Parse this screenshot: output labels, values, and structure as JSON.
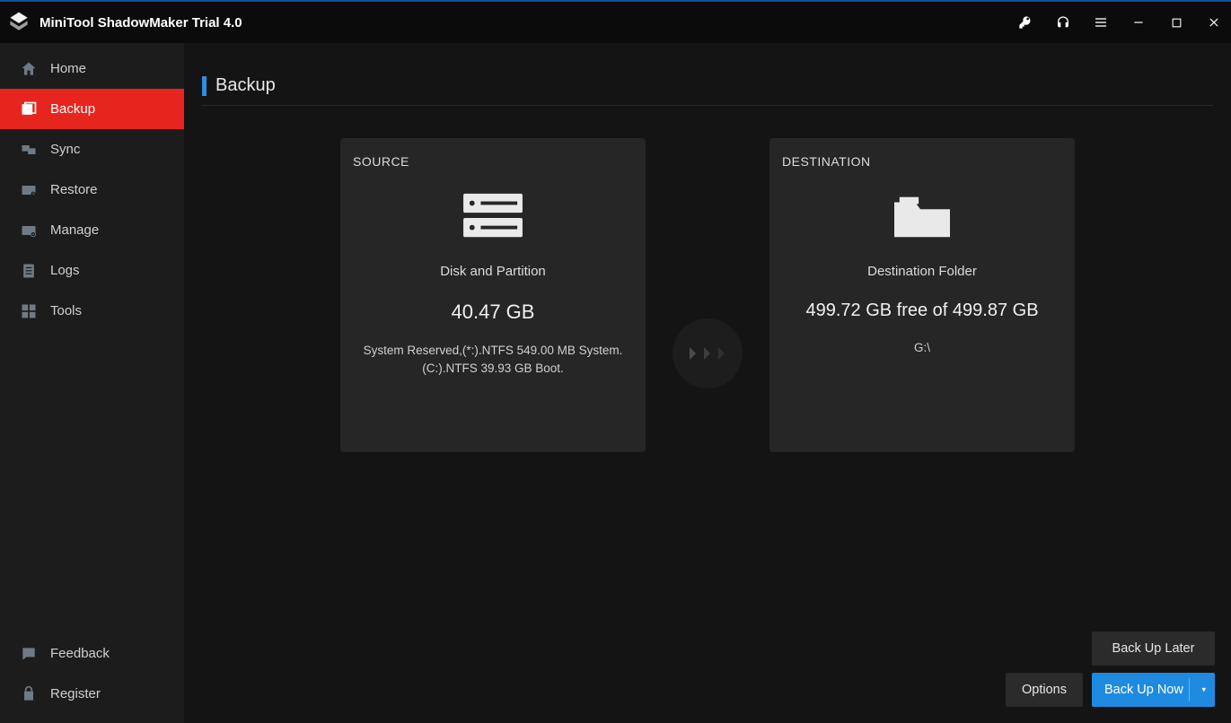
{
  "app": {
    "title": "MiniTool ShadowMaker Trial 4.0"
  },
  "titlebar_icons": {
    "key": "key-icon",
    "help": "headset-icon",
    "menu": "menu-icon",
    "minimize": "minimize-icon",
    "maximize": "maximize-icon",
    "close": "close-icon"
  },
  "sidebar": {
    "items": [
      {
        "label": "Home",
        "icon": "home-icon",
        "active": false
      },
      {
        "label": "Backup",
        "icon": "backup-icon",
        "active": true
      },
      {
        "label": "Sync",
        "icon": "sync-icon",
        "active": false
      },
      {
        "label": "Restore",
        "icon": "restore-icon",
        "active": false
      },
      {
        "label": "Manage",
        "icon": "manage-icon",
        "active": false
      },
      {
        "label": "Logs",
        "icon": "logs-icon",
        "active": false
      },
      {
        "label": "Tools",
        "icon": "tools-icon",
        "active": false
      }
    ],
    "bottom": [
      {
        "label": "Feedback",
        "icon": "feedback-icon"
      },
      {
        "label": "Register",
        "icon": "register-icon"
      }
    ]
  },
  "page": {
    "title": "Backup"
  },
  "source": {
    "heading": "SOURCE",
    "type_label": "Disk and Partition",
    "total_size": "40.47 GB",
    "detail": "System Reserved,(*:).NTFS 549.00 MB System.(C:).NTFS 39.93 GB Boot."
  },
  "destination": {
    "heading": "DESTINATION",
    "type_label": "Destination Folder",
    "space_line": "499.72 GB free of 499.87 GB",
    "path": "G:\\"
  },
  "buttons": {
    "options": "Options",
    "back_up_later": "Back Up Later",
    "back_up_now": "Back Up Now"
  }
}
